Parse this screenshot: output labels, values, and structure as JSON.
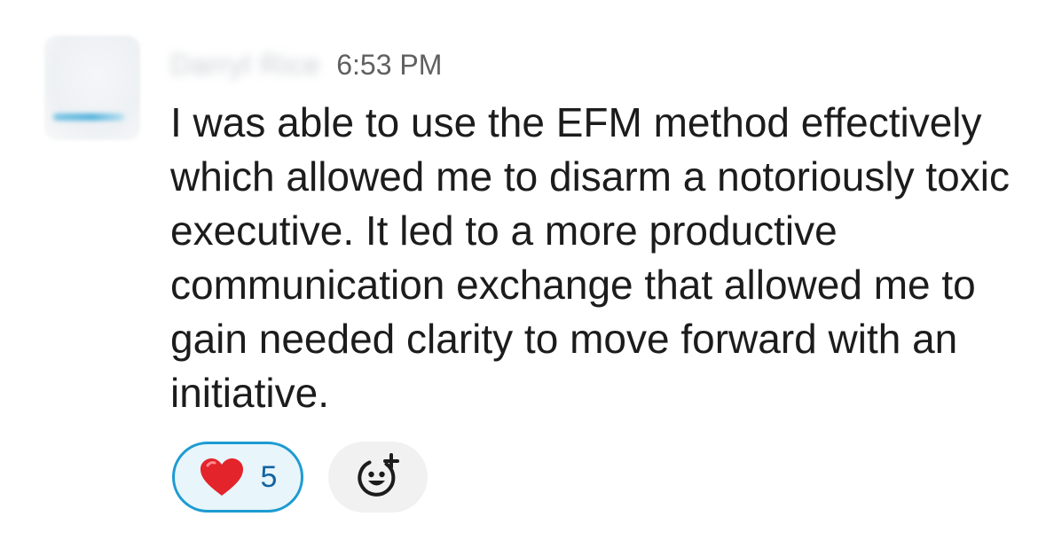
{
  "message": {
    "sender_name": "Darryl Rice",
    "timestamp": "6:53 PM",
    "text": "I was able to use the EFM method effectively which allowed me to disarm a notoriously toxic executive. It led to a more productive communication exchange that allowed me to gain needed clarity to move forward with an initiative."
  },
  "reactions": [
    {
      "icon": "red-heart-icon",
      "count": "5",
      "selected": true
    }
  ],
  "add_reaction": {
    "icon": "add-emoji-icon"
  },
  "colors": {
    "text": "#1d1c1d",
    "timestamp": "#616061",
    "reaction_border": "#1d9bd1",
    "reaction_bg": "#e8f5fa",
    "reaction_count": "#1264a3",
    "heart": "#e3242b",
    "add_reaction_bg": "#f1f1f1"
  }
}
